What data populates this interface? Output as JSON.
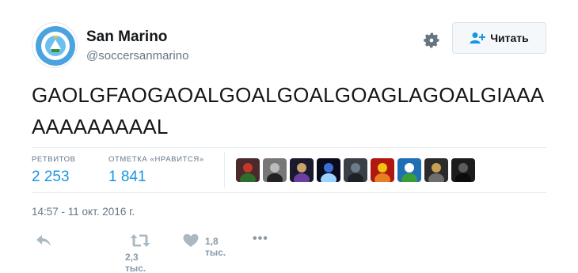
{
  "account": {
    "name": "San Marino",
    "handle": "@soccersanmarino",
    "avatar_icon": "federation-crest-icon"
  },
  "follow_button": {
    "label": "Читать",
    "icon": "follow-person-plus-icon"
  },
  "settings_icon": "gear-icon",
  "tweet": {
    "text": "GAOLGFAOGAOALGOALGOALGOAGLAGOALGIAAAAAAAAAAAAL"
  },
  "stats": {
    "retweets": {
      "label": "РЕТВИТОВ",
      "value": "2 253"
    },
    "likes": {
      "label": "ОТМЕТКА «НРАВИТСЯ»",
      "value": "1 841"
    }
  },
  "likers": [
    {
      "name": "liker-avatar-1",
      "colors": [
        "#4a2a2a",
        "#c0392b",
        "#2c6e2c"
      ]
    },
    {
      "name": "liker-avatar-2",
      "colors": [
        "#777777",
        "#bbbbbb",
        "#222222"
      ]
    },
    {
      "name": "liker-avatar-3",
      "colors": [
        "#1a1a2e",
        "#c9a36b",
        "#6b3fa0"
      ]
    },
    {
      "name": "liker-avatar-4",
      "colors": [
        "#0b0b1e",
        "#3b6fd6",
        "#9bd3ff"
      ]
    },
    {
      "name": "liker-avatar-5",
      "colors": [
        "#3a3f47",
        "#6c7a89",
        "#1e2228"
      ]
    },
    {
      "name": "liker-avatar-6",
      "colors": [
        "#b0170f",
        "#f1c40f",
        "#e67e22"
      ]
    },
    {
      "name": "liker-avatar-7",
      "colors": [
        "#1f6fb5",
        "#ffffff",
        "#3a9d3a"
      ]
    },
    {
      "name": "liker-avatar-8",
      "colors": [
        "#2b2b2b",
        "#c8a050",
        "#6e6e6e"
      ]
    },
    {
      "name": "liker-avatar-9",
      "colors": [
        "#1c1c1c",
        "#5c5c5c",
        "#0c0c0c"
      ]
    }
  ],
  "timestamp": "14:57 - 11 окт. 2016 г.",
  "actions": {
    "reply_icon": "reply-icon",
    "retweet_icon": "retweet-icon",
    "retweet_count": "2,3 тыс.",
    "like_icon": "heart-icon",
    "like_count": "1,8 тыс.",
    "more_icon": "more-dots-icon",
    "more_glyph": "•••"
  },
  "colors": {
    "link_blue": "#1b95e0",
    "muted": "#657786",
    "icon_grey": "#aab8c2"
  }
}
